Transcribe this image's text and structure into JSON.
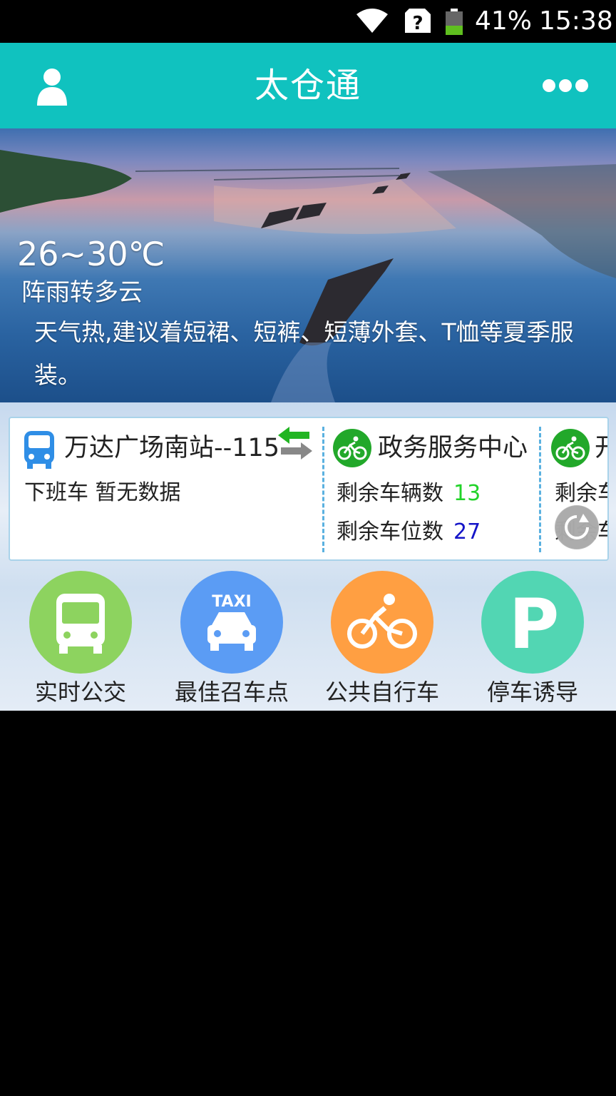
{
  "status_bar": {
    "battery_percent": "41%",
    "time": "15:38"
  },
  "header": {
    "title": "太仓通",
    "left_icon": "user-icon",
    "right_icon": "more-icon"
  },
  "weather": {
    "temp_range": "26~30℃",
    "condition": "阵雨转多云",
    "tip": "天气热,建议着短裙、短裤、短薄外套、T恤等夏季服装。"
  },
  "info_card": {
    "bus": {
      "title": "万达广场南站--115",
      "subtitle": "下班车  暂无数据"
    },
    "bike1": {
      "title": "政务服务中心",
      "bikes_label": "剩余车辆数",
      "bikes_value": "13",
      "slots_label": "剩余车位数",
      "slots_value": "27"
    },
    "bike2": {
      "title": "开",
      "bikes_label": "剩余车",
      "slots_label": "剩余车"
    }
  },
  "quick_entries": [
    {
      "label": "实时公交",
      "icon": "bus-icon",
      "color": "#8dd35f"
    },
    {
      "label": "最佳召车点",
      "icon": "taxi-icon",
      "color": "#5b9cf4"
    },
    {
      "label": "公共自行车",
      "icon": "bicycle-icon",
      "color": "#ff9f42"
    },
    {
      "label": "停车诱导",
      "icon": "parking-icon",
      "color": "#52d6b3"
    }
  ],
  "colors": {
    "header_bg": "#10c2bf",
    "card_border": "#a9d3ea",
    "value_green": "#22d329",
    "value_blue": "#1515c8"
  }
}
